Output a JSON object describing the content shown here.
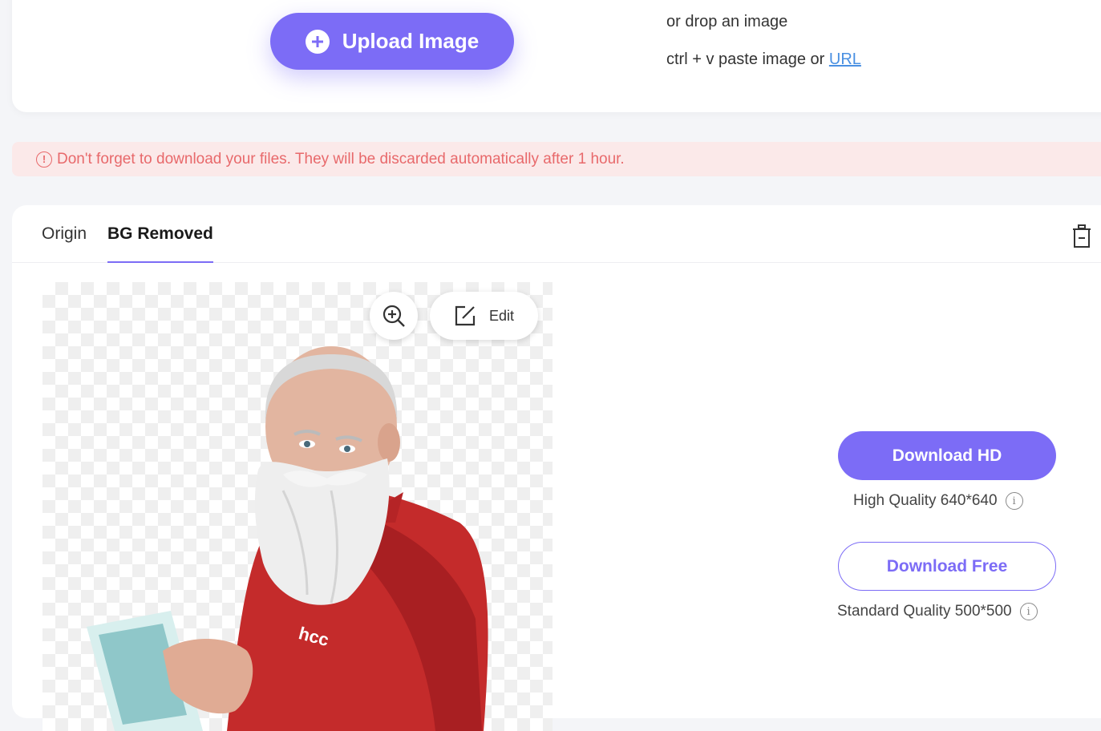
{
  "upload": {
    "button_label": "Upload Image",
    "drop_text": "or drop an image",
    "paste_text": "ctrl + v paste image or",
    "url_link": "URL"
  },
  "notice": {
    "icon": "!",
    "text": "Don't forget to download your files. They will be discarded automatically after 1 hour."
  },
  "tabs": [
    {
      "label": "Origin",
      "active": false
    },
    {
      "label": "BG Removed",
      "active": true
    }
  ],
  "preview": {
    "edit_label": "Edit",
    "shirt_text": "hcc"
  },
  "downloads": {
    "hd_label": "Download HD",
    "hd_quality": "High Quality 640*640",
    "free_label": "Download Free",
    "free_quality": "Standard Quality 500*500",
    "info_icon": "i"
  },
  "colors": {
    "accent": "#7c6cf6",
    "notice_bg": "#fbe9e9",
    "notice_text": "#e8696b",
    "link": "#4a90e2"
  }
}
